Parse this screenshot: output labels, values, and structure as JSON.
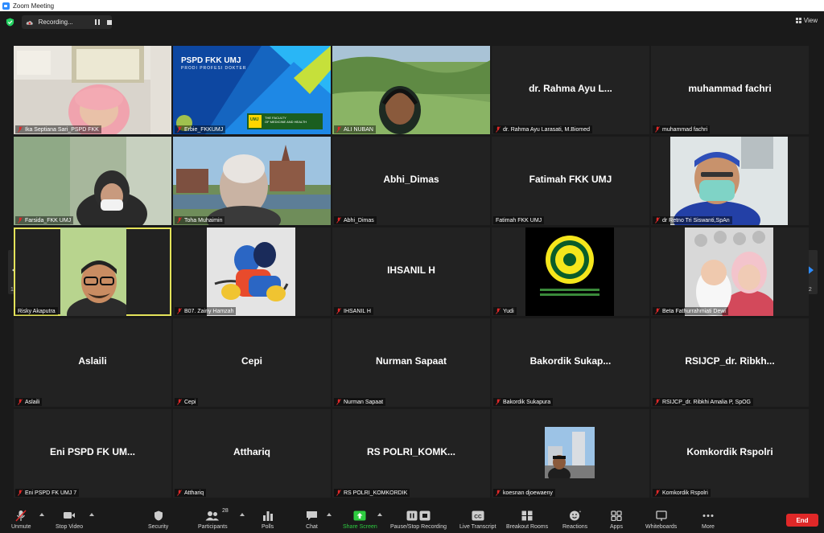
{
  "window": {
    "title": "Zoom Meeting"
  },
  "topbar": {
    "recording_label": "Recording...",
    "view_label": "View"
  },
  "colors": {
    "active_speaker": "#e4e35a",
    "end_button": "#e02828",
    "muted_mic": "#e02828",
    "share_green": "#2ecc40",
    "pager_blue": "#2d8cff"
  },
  "gallery": {
    "page_indicator": "1/2",
    "tiles": [
      {
        "name": "Ika Septiana Sari_PSPD FKK",
        "muted": true,
        "video": "person-pink-hijab"
      },
      {
        "name": "Erbie_FKKUMJ",
        "muted": true,
        "video": "virtual-background"
      },
      {
        "name": "ALI NUBAN",
        "muted": true,
        "video": "person-landscape"
      },
      {
        "display": "dr. Rahma Ayu L...",
        "name": "dr. Rahma Ayu Larasati, M.Biomed",
        "muted": true
      },
      {
        "display": "muhammad fachri",
        "name": "muhammad fachri",
        "muted": true
      },
      {
        "name": "Farsida_FKK UMJ",
        "muted": true,
        "video": "person-mask"
      },
      {
        "name": "Toha Muhaimin",
        "muted": true,
        "video": "person-pagoda"
      },
      {
        "display": "Abhi_Dimas",
        "name": "Abhi_Dimas",
        "muted": true
      },
      {
        "display": "Fatimah FKK UMJ",
        "name": "Fatimah FKK UMJ",
        "muted": false
      },
      {
        "name": "dr Retno Tri Siswanti,SpAn",
        "muted": true,
        "video": "person-surgical"
      },
      {
        "name": "Risky Akaputra",
        "muted": false,
        "active": true,
        "video": "person-glasses"
      },
      {
        "name": "B07.  Zainy Hamzah",
        "muted": true,
        "video": "motorbike-photo"
      },
      {
        "display": "IHSANIL H",
        "name": "IHSANIL H",
        "muted": true
      },
      {
        "name": "Yudi",
        "muted": true,
        "video": "logo-seal"
      },
      {
        "name": "Beta Fathurrahmiati Dewi",
        "muted": true,
        "video": "mother-child-photo"
      },
      {
        "display": "Aslaili",
        "name": "Aslaili",
        "muted": true
      },
      {
        "display": "Cepi",
        "name": "Cepi",
        "muted": true
      },
      {
        "display": "Nurman Sapaat",
        "name": "Nurman Sapaat",
        "muted": true
      },
      {
        "display": "Bakordik  Sukap...",
        "name": "Bakordik Sukapura",
        "muted": true
      },
      {
        "display": "RSIJCP_dr.  Ribkh...",
        "name": "RSIJCP_dr. Ribkhi Amalia P, SpOG",
        "muted": true
      },
      {
        "display": "Eni PSPD FK UM...",
        "name": "Eni PSPD FK UMJ 7",
        "muted": true
      },
      {
        "display": "Atthariq",
        "name": "Atthariq",
        "muted": true
      },
      {
        "display": "RS  POLRI_KOMK...",
        "name": "RS POLRI_KOMKORDIK",
        "muted": true
      },
      {
        "name": "koesnan djoewaeny",
        "muted": true,
        "video": "person-city-photo"
      },
      {
        "display": "Komkordik Rspolri",
        "name": "Komkordik Rspolri",
        "muted": true
      }
    ],
    "erbie_bg": {
      "title": "PSPD FKK UMJ",
      "subtitle": "PRODI PROFESI DOKTER",
      "badge": "UMJ",
      "badge_text": "THE FACULTY\nOF MEDICINE AND HEALTH"
    }
  },
  "toolbar": {
    "unmute": "Unmute",
    "stop_video": "Stop Video",
    "security": "Security",
    "participants": "Participants",
    "participants_count": "28",
    "polls": "Polls",
    "chat": "Chat",
    "share_screen": "Share Screen",
    "pause_recording": "Pause/Stop Recording",
    "live_transcript": "Live Transcript",
    "breakout_rooms": "Breakout Rooms",
    "reactions": "Reactions",
    "apps": "Apps",
    "whiteboards": "Whiteboards",
    "more": "More",
    "end": "End"
  }
}
